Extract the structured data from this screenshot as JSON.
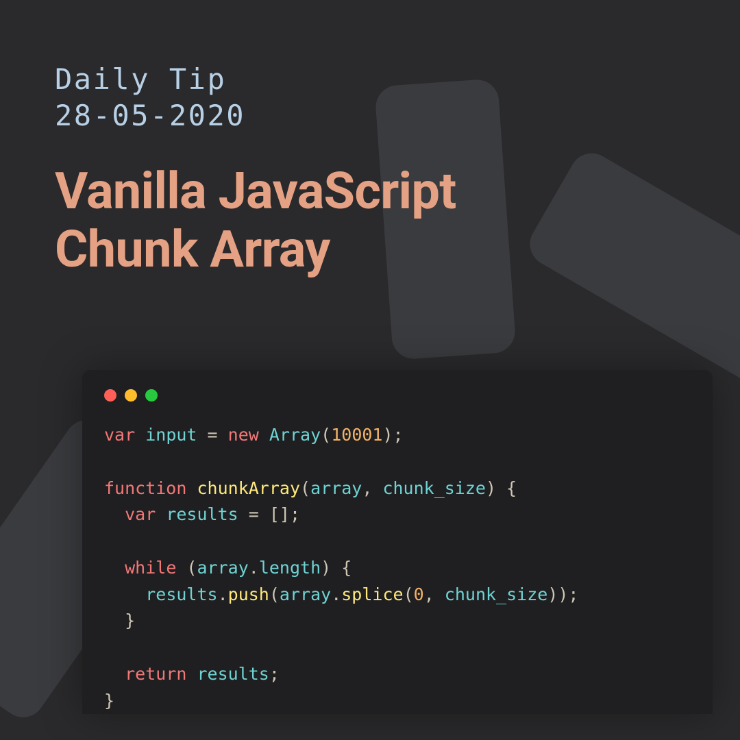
{
  "header": {
    "subtitle_line1": "Daily Tip",
    "subtitle_line2": "28-05-2020",
    "title_line1": "Vanilla JavaScript",
    "title_line2": "Chunk Array"
  },
  "code": {
    "l1_kw_var": "var",
    "l1_var_input": "input",
    "l1_op_eq": "=",
    "l1_kw_new": "new",
    "l1_class_array": "Array",
    "l1_paren_open": "(",
    "l1_num": "10001",
    "l1_paren_close_semi": ");",
    "l3_kw_function": "function",
    "l3_fn_name": "chunkArray",
    "l3_paren_open": "(",
    "l3_param1": "array",
    "l3_comma_sp": ", ",
    "l3_param2": "chunk_size",
    "l3_paren_close_sp_brace": ") {",
    "l4_indent": "  ",
    "l4_kw_var": "var",
    "l4_var_results": "results",
    "l4_op_eq": "=",
    "l4_brackets_semi": "[];",
    "l6_indent": "  ",
    "l6_kw_while": "while",
    "l6_sp_paren_open": " (",
    "l6_var_array": "array",
    "l6_dot": ".",
    "l6_prop_length": "length",
    "l6_paren_close_sp_brace": ") {",
    "l7_indent": "    ",
    "l7_var_results": "results",
    "l7_dot1": ".",
    "l7_method_push": "push",
    "l7_paren_open": "(",
    "l7_var_array": "array",
    "l7_dot2": ".",
    "l7_method_splice": "splice",
    "l7_paren_open2": "(",
    "l7_num_zero": "0",
    "l7_comma_sp": ", ",
    "l7_var_chunk": "chunk_size",
    "l7_close": "));",
    "l8_indent_brace": "  }",
    "l10_indent": "  ",
    "l10_kw_return": "return",
    "l10_sp": " ",
    "l10_var_results": "results",
    "l10_semi": ";",
    "l11_brace": "}"
  }
}
